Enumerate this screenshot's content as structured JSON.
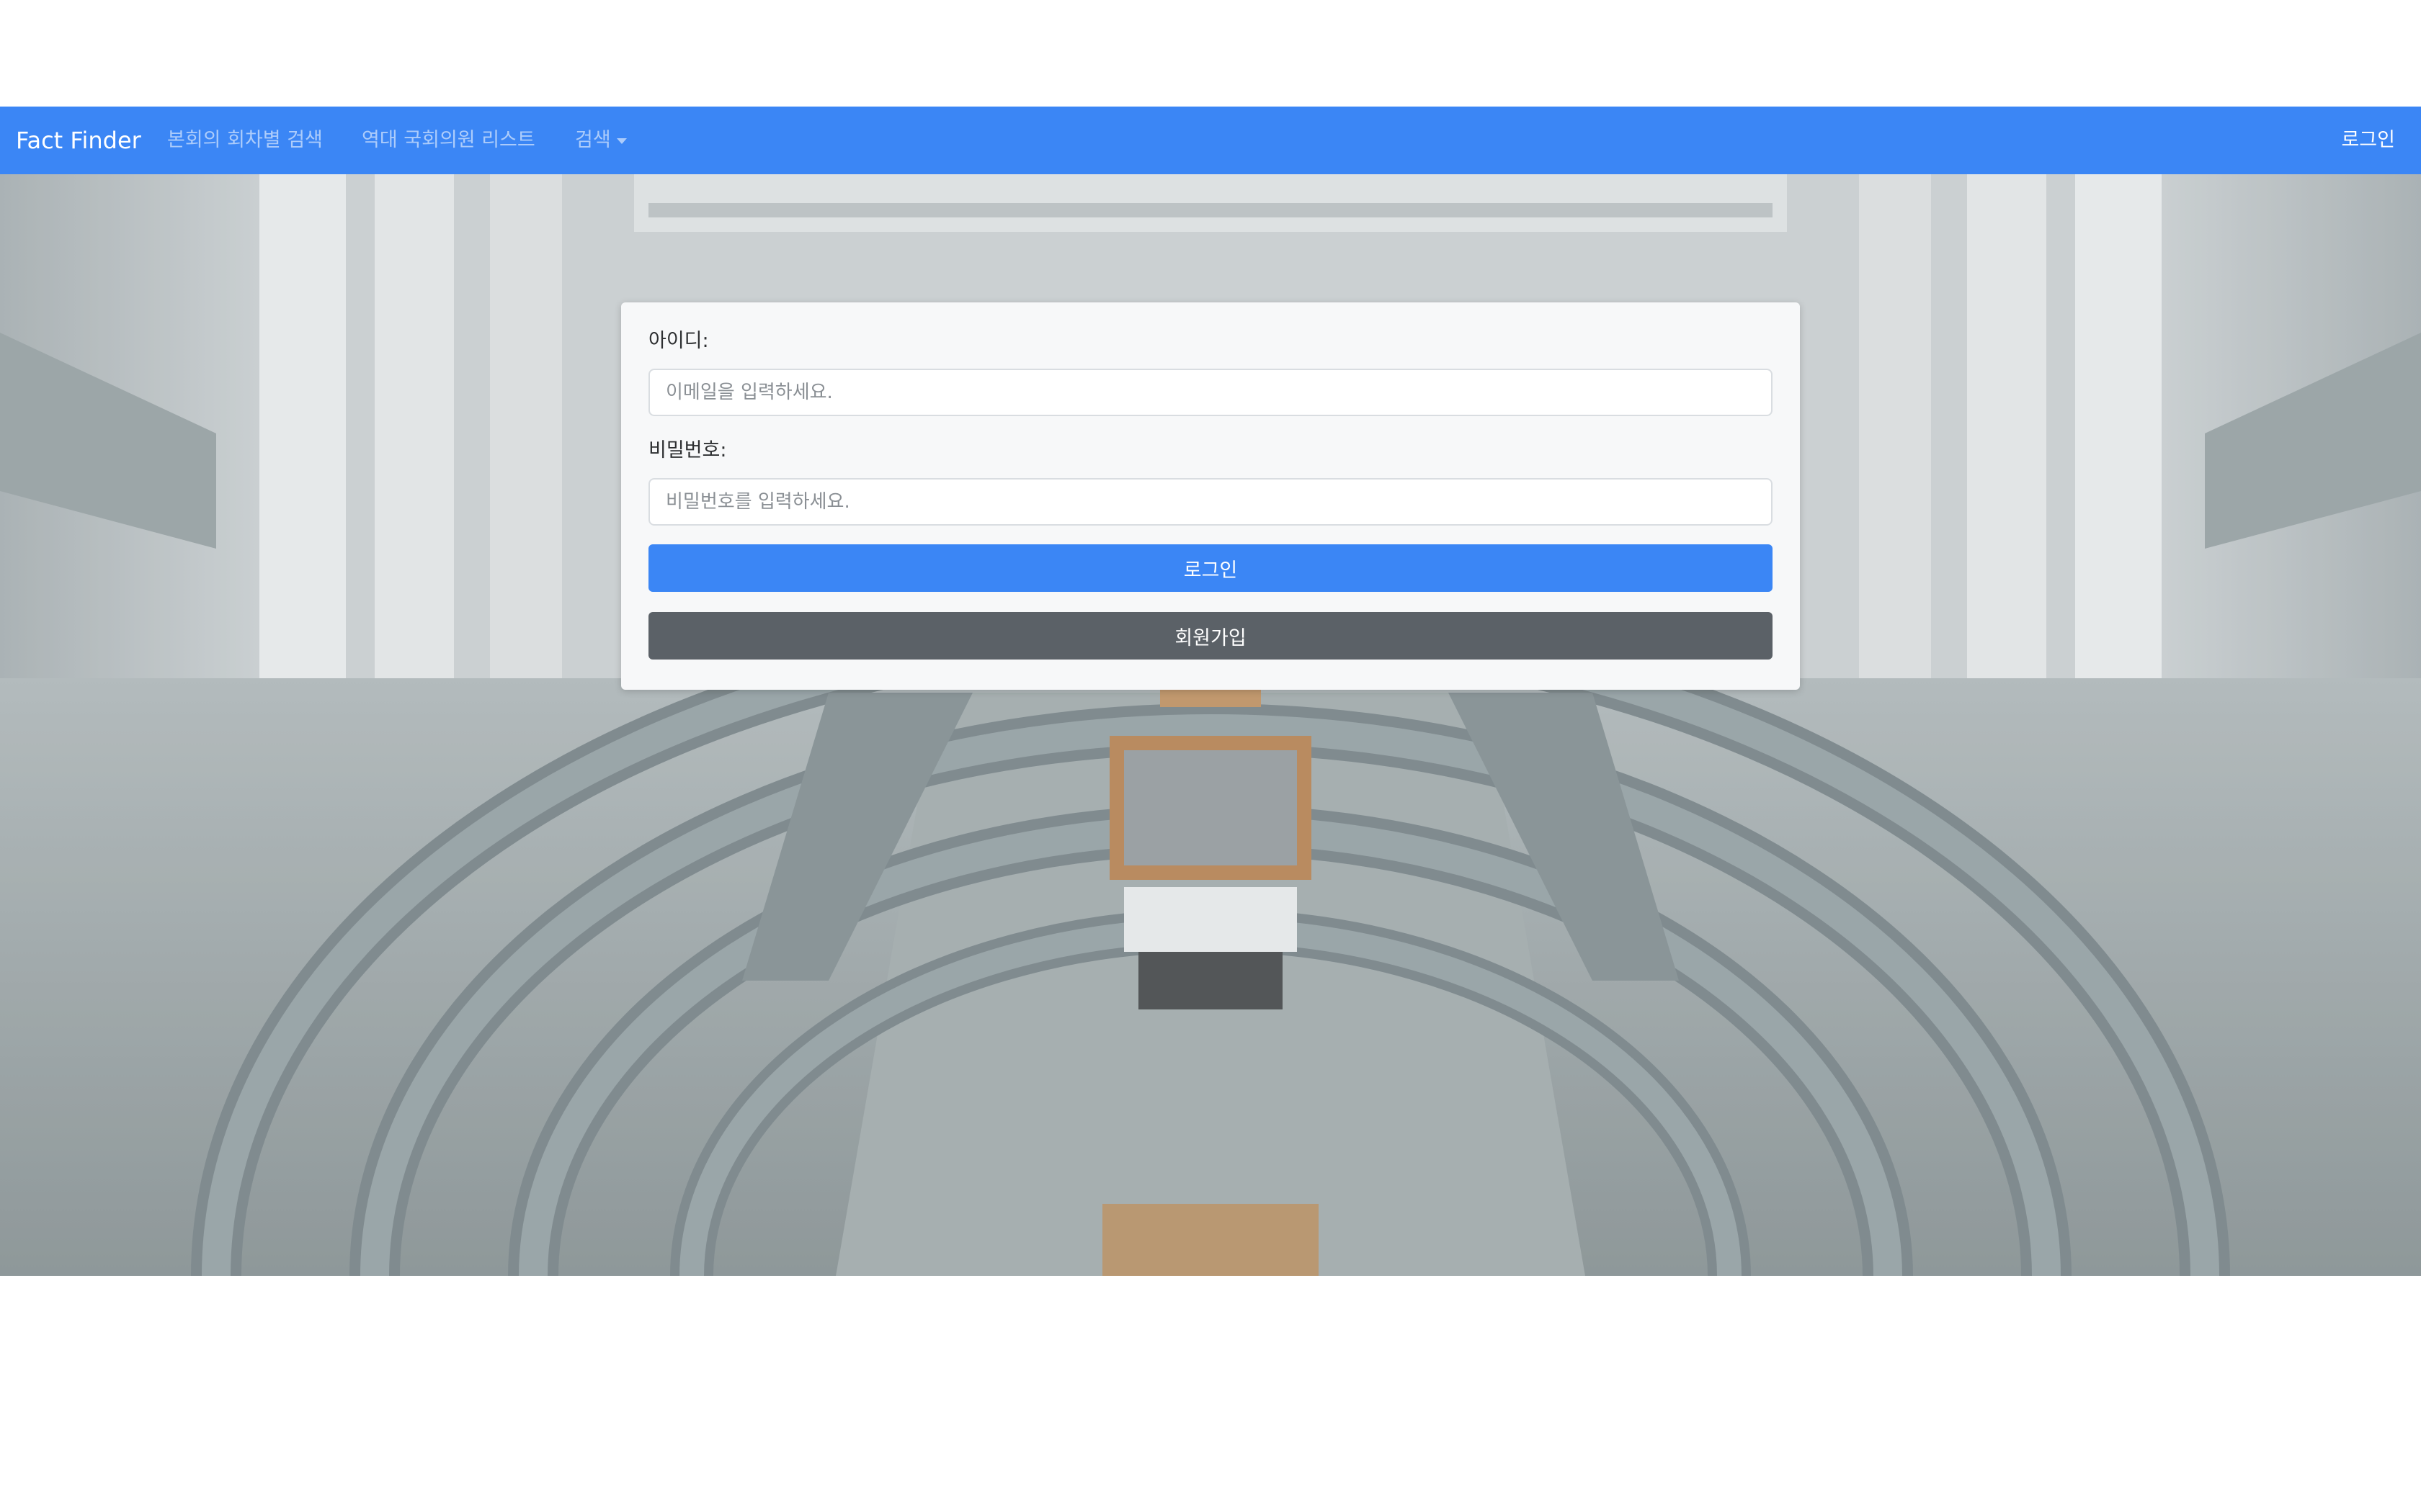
{
  "navbar": {
    "brand": "Fact Finder",
    "links": [
      {
        "label": "본회의 회차별 검색",
        "icon": null
      },
      {
        "label": "역대 국회의원 리스트",
        "icon": null
      },
      {
        "label": "검색",
        "icon": "caret-down-icon"
      }
    ],
    "login_label": "로그인"
  },
  "login_form": {
    "id_label": "아이디:",
    "id_placeholder": "이메일을 입력하세요.",
    "password_label": "비밀번호:",
    "password_placeholder": "비밀번호를 입력하세요.",
    "login_button": "로그인",
    "signup_button": "회원가입"
  },
  "colors": {
    "primary": "#3b86f5",
    "secondary": "#5b6167",
    "card_bg": "#f7f8f9"
  }
}
